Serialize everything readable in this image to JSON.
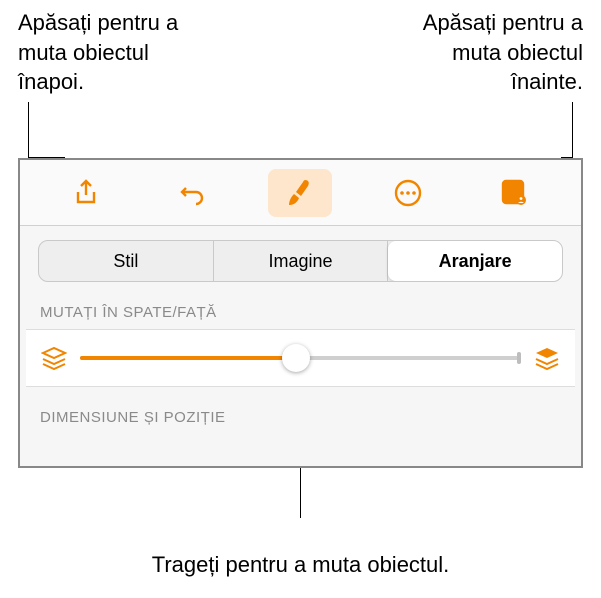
{
  "callouts": {
    "left": "Apăsați pentru a muta obiectul înapoi.",
    "right": "Apăsați pentru a muta obiectul înainte.",
    "bottom": "Trageți pentru a muta obiectul."
  },
  "toolbar": {
    "share": "share",
    "undo": "undo",
    "format": "format",
    "more": "more",
    "presenter": "presenter-view"
  },
  "tabs": {
    "style": "Stil",
    "image": "Imagine",
    "arrange": "Aranjare"
  },
  "sections": {
    "moveBackFront": "MUTAȚI ÎN SPATE/FAȚĂ",
    "sizePosition": "DIMENSIUNE ȘI POZIȚIE"
  },
  "slider": {
    "percent": 49
  }
}
